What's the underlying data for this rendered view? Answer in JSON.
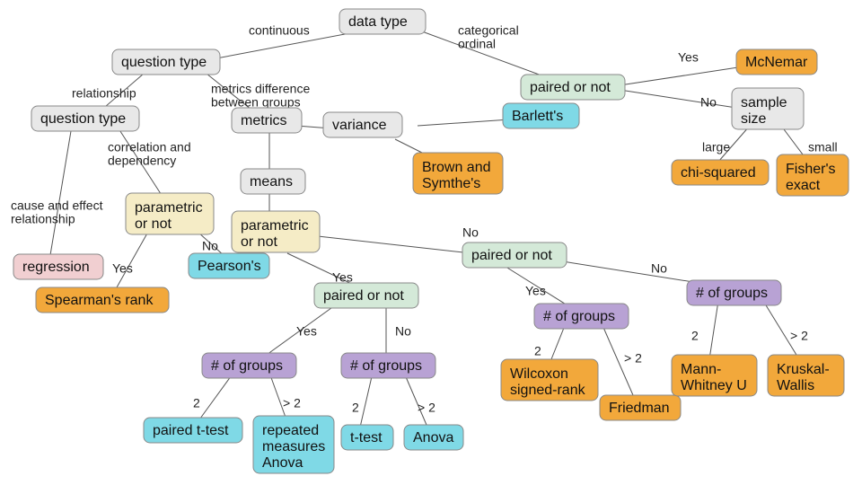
{
  "chart_data": {
    "type": "decision-tree",
    "title": "Statistical test selection",
    "root": "data_type",
    "nodes": {
      "data_type": {
        "label": "data type",
        "kind": "question",
        "children": [
          {
            "edge": "continuous",
            "to": "qtype1"
          },
          {
            "edge": "categorical ordinal",
            "to": "paired_cat"
          }
        ]
      },
      "qtype1": {
        "label": "question type",
        "kind": "question",
        "children": [
          {
            "edge": "relationship",
            "to": "qtype2"
          },
          {
            "edge": "metrics difference between groups",
            "to": "metrics"
          }
        ]
      },
      "qtype2": {
        "label": "question type",
        "kind": "question",
        "children": [
          {
            "edge": "cause and effect relationship",
            "to": "regression"
          },
          {
            "edge": "correlation and dependency",
            "to": "param_corr"
          }
        ]
      },
      "regression": {
        "label": "regression",
        "kind": "result"
      },
      "param_corr": {
        "label": "parametric or not",
        "kind": "question",
        "children": [
          {
            "edge": "Yes",
            "to": "spearman"
          },
          {
            "edge": "No",
            "to": "pearson"
          }
        ]
      },
      "spearman": {
        "label": "Spearman's rank",
        "kind": "result"
      },
      "pearson": {
        "label": "Pearson's",
        "kind": "result"
      },
      "metrics": {
        "label": "metrics",
        "kind": "question",
        "children": [
          {
            "edge": "variance",
            "to": "variance"
          },
          {
            "edge": "means",
            "to": "means"
          }
        ]
      },
      "variance": {
        "label": "variance",
        "kind": "question",
        "children": [
          {
            "edge": "",
            "to": "barlett"
          },
          {
            "edge": "",
            "to": "brown"
          }
        ]
      },
      "barlett": {
        "label": "Barlett's",
        "kind": "result"
      },
      "brown": {
        "label": "Brown and Symthe's",
        "kind": "result"
      },
      "means": {
        "label": "means",
        "kind": "question",
        "children": [
          {
            "edge": "",
            "to": "param_means"
          }
        ]
      },
      "param_means": {
        "label": "parametric or not",
        "kind": "question",
        "children": [
          {
            "edge": "Yes",
            "to": "paired_param"
          },
          {
            "edge": "No",
            "to": "paired_nonparam"
          }
        ]
      },
      "paired_param": {
        "label": "paired or not",
        "kind": "question",
        "children": [
          {
            "edge": "Yes",
            "to": "groups_paired_param"
          },
          {
            "edge": "No",
            "to": "groups_unpaired_param"
          }
        ]
      },
      "groups_paired_param": {
        "label": "# of groups",
        "kind": "question",
        "children": [
          {
            "edge": "2",
            "to": "paired_ttest"
          },
          {
            "edge": "> 2",
            "to": "rm_anova"
          }
        ]
      },
      "paired_ttest": {
        "label": "paired t-test",
        "kind": "result"
      },
      "rm_anova": {
        "label": "repeated measures Anova",
        "kind": "result"
      },
      "groups_unpaired_param": {
        "label": "# of groups",
        "kind": "question",
        "children": [
          {
            "edge": "2",
            "to": "ttest"
          },
          {
            "edge": "> 2",
            "to": "anova"
          }
        ]
      },
      "ttest": {
        "label": "t-test",
        "kind": "result"
      },
      "anova": {
        "label": "Anova",
        "kind": "result"
      },
      "paired_nonparam": {
        "label": "paired or not",
        "kind": "question",
        "children": [
          {
            "edge": "Yes",
            "to": "groups_paired_np"
          },
          {
            "edge": "No",
            "to": "groups_unpaired_np"
          }
        ]
      },
      "groups_paired_np": {
        "label": "# of groups",
        "kind": "question",
        "children": [
          {
            "edge": "2",
            "to": "wilcoxon"
          },
          {
            "edge": "> 2",
            "to": "friedman"
          }
        ]
      },
      "wilcoxon": {
        "label": "Wilcoxon signed-rank",
        "kind": "result"
      },
      "friedman": {
        "label": "Friedman",
        "kind": "result"
      },
      "groups_unpaired_np": {
        "label": "# of groups",
        "kind": "question",
        "children": [
          {
            "edge": "2",
            "to": "mannwhitney"
          },
          {
            "edge": "> 2",
            "to": "kruskal"
          }
        ]
      },
      "mannwhitney": {
        "label": "Mann-Whitney U",
        "kind": "result"
      },
      "kruskal": {
        "label": "Kruskal-Wallis",
        "kind": "result"
      },
      "paired_cat": {
        "label": "paired or not",
        "kind": "question",
        "children": [
          {
            "edge": "Yes",
            "to": "mcnemar"
          },
          {
            "edge": "No",
            "to": "sample_size"
          }
        ]
      },
      "mcnemar": {
        "label": "McNemar",
        "kind": "result"
      },
      "sample_size": {
        "label": "sample size",
        "kind": "question",
        "children": [
          {
            "edge": "large",
            "to": "chisq"
          },
          {
            "edge": "small",
            "to": "fisher"
          }
        ]
      },
      "chisq": {
        "label": "chi-squared",
        "kind": "result"
      },
      "fisher": {
        "label": "Fisher's exact",
        "kind": "result"
      }
    }
  },
  "nodes": {
    "data_type": "data type",
    "qtype1": "question type",
    "qtype2": "question type",
    "regression": "regression",
    "param_corr": "parametric or not",
    "spearman": "Spearman's rank",
    "pearson": "Pearson's",
    "metrics": "metrics",
    "variance": "variance",
    "barlett": "Barlett's",
    "brown_l1": "Brown and",
    "brown_l2": "Symthe's",
    "means": "means",
    "param_means_l1": "parametric",
    "param_means_l2": "or not",
    "paired_param": "paired or not",
    "groups_paired_param": "# of groups",
    "paired_ttest": "paired t-test",
    "rm_anova_l1": "repeated",
    "rm_anova_l2": "measures",
    "rm_anova_l3": "Anova",
    "groups_unpaired_param": "# of groups",
    "ttest": "t-test",
    "anova": "Anova",
    "paired_nonparam": "paired or not",
    "groups_paired_np": "# of groups",
    "wilcoxon_l1": "Wilcoxon",
    "wilcoxon_l2": "signed-rank",
    "friedman": "Friedman",
    "groups_unpaired_np": "# of groups",
    "mannwhitney_l1": "Mann-",
    "mannwhitney_l2": "Whitney U",
    "kruskal_l1": "Kruskal-",
    "kruskal_l2": "Wallis",
    "paired_cat": "paired or not",
    "mcnemar": "McNemar",
    "sample_size_l1": "sample",
    "sample_size_l2": "size",
    "chisq": "chi-squared",
    "fisher_l1": "Fisher's",
    "fisher_l2": "exact",
    "param_corr_l1": "parametric",
    "param_corr_l2": "or not"
  },
  "edges": {
    "continuous": "continuous",
    "categorical_l1": "categorical",
    "categorical_l2": "ordinal",
    "relationship": "relationship",
    "metrics_diff_l1": "metrics difference",
    "metrics_diff_l2": "between groups",
    "cause_l1": "cause and effect",
    "cause_l2": "relationship",
    "corr_l1": "correlation and",
    "corr_l2": "dependency",
    "yes": "Yes",
    "no": "No",
    "large": "large",
    "small": "small",
    "two": "2",
    "gt2": "> 2"
  },
  "colors": {
    "gray": "#e8e8e8",
    "green": "#d4e9d8",
    "orange": "#f2a83b",
    "cyan": "#7fd9e6",
    "purple": "#b8a2d4",
    "cream": "#f5ecc6",
    "pink": "#f1cfd1"
  }
}
